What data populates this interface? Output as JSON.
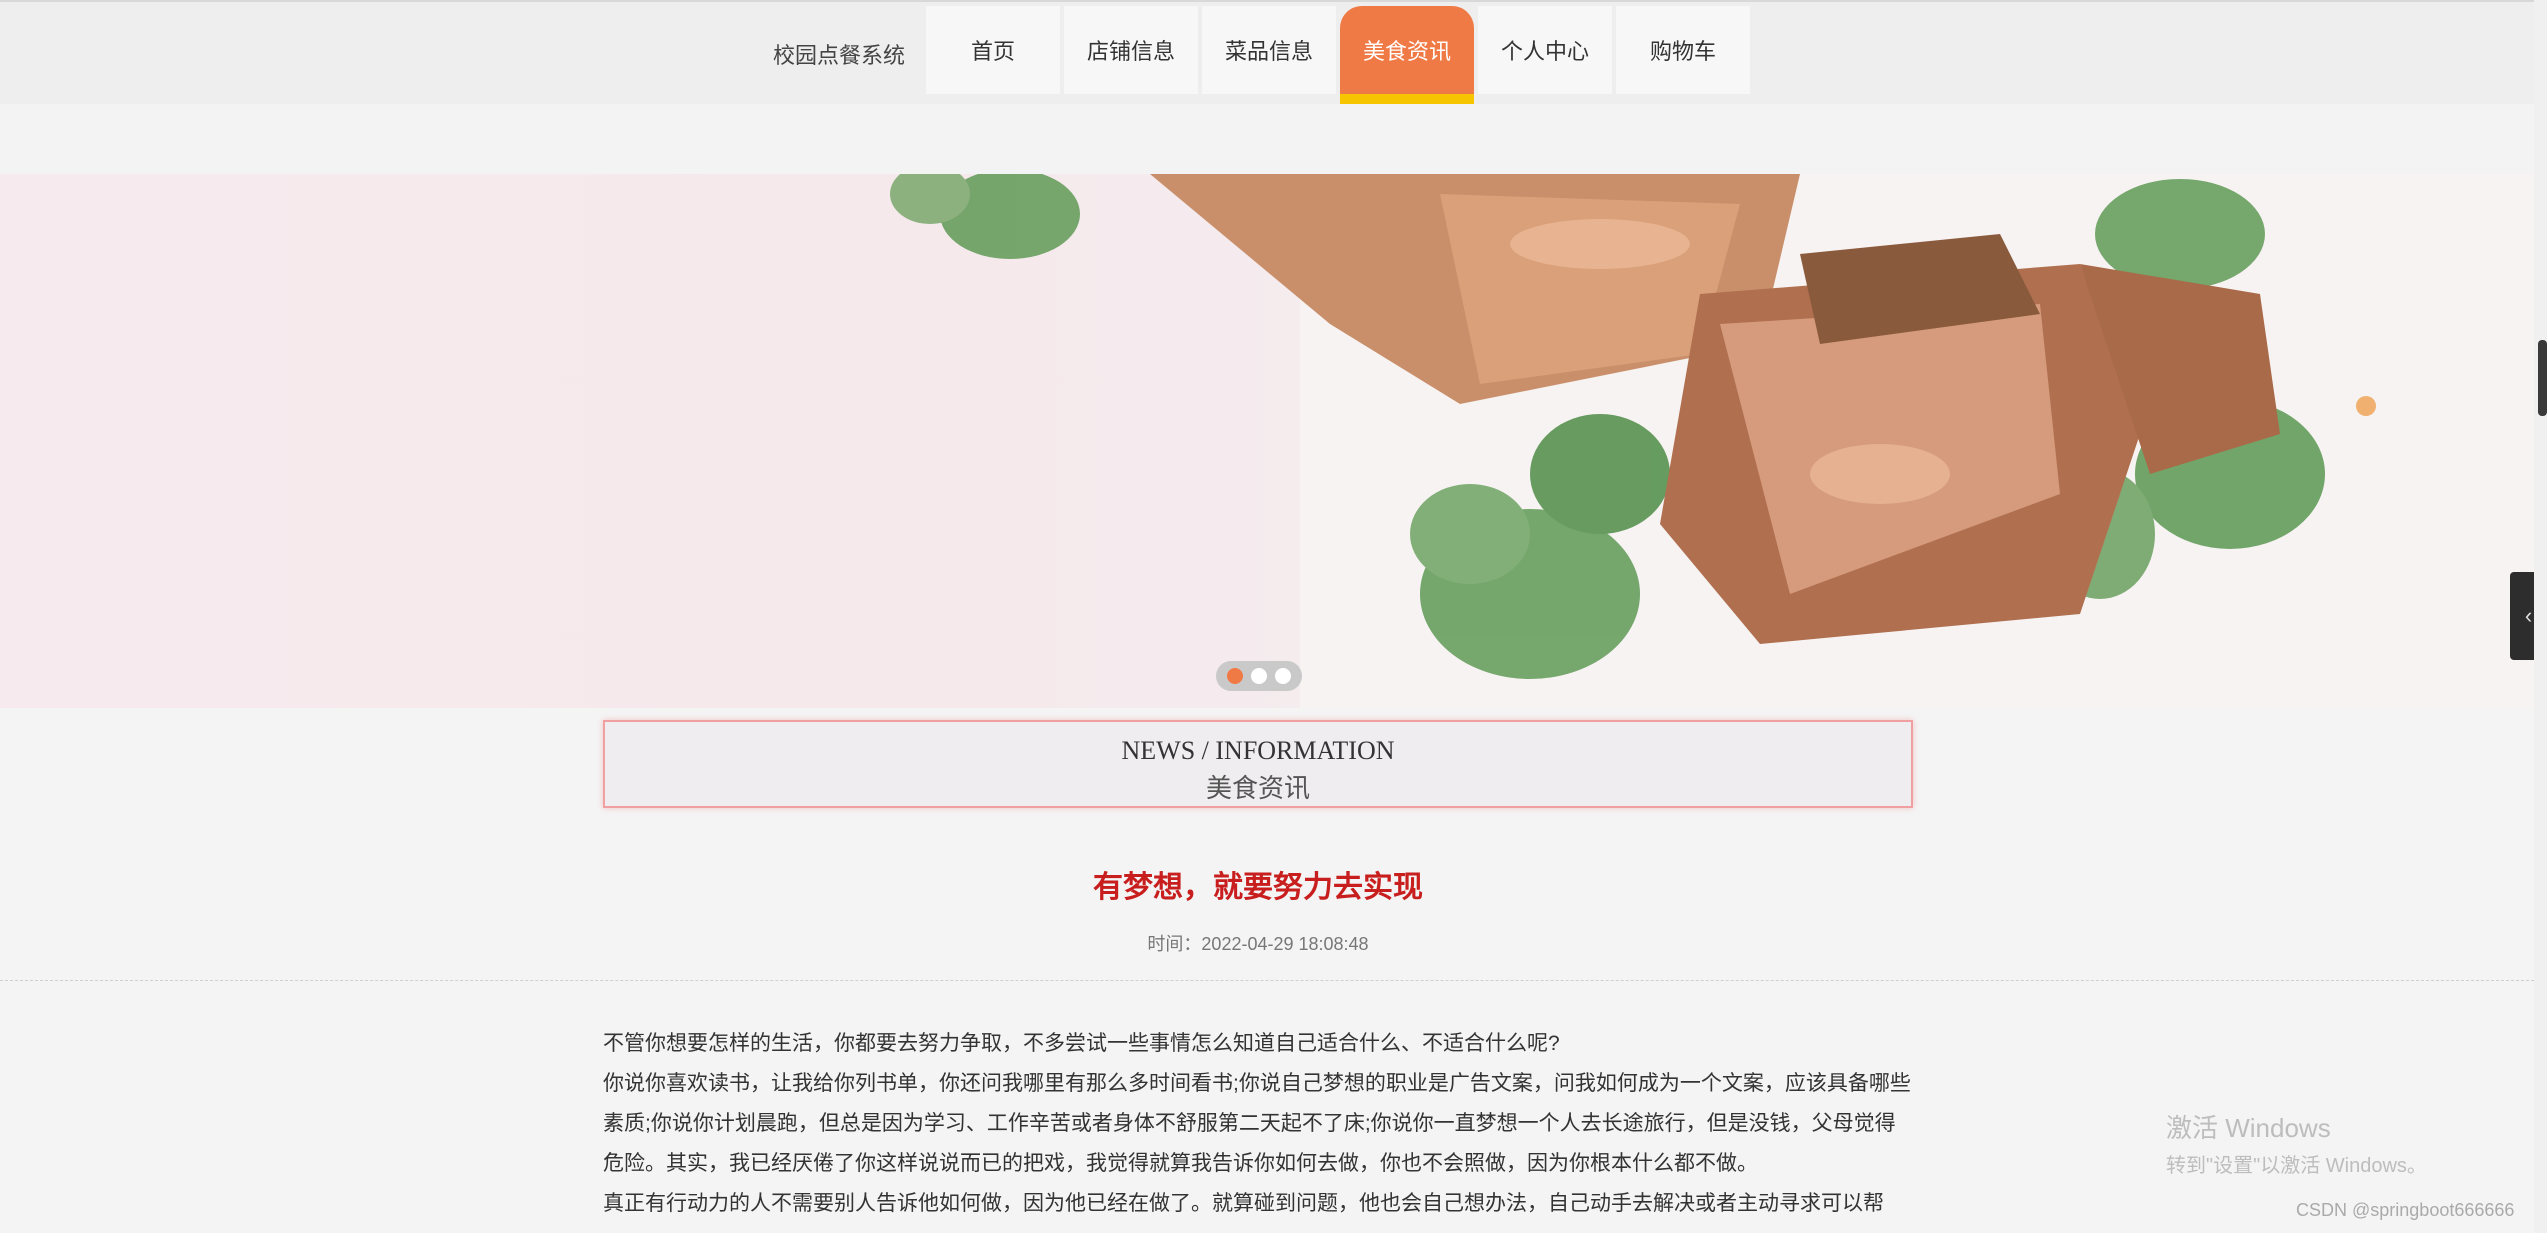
{
  "brand": "校园点餐系统",
  "nav": [
    {
      "label": "首页",
      "active": false
    },
    {
      "label": "店铺信息",
      "active": false
    },
    {
      "label": "菜品信息",
      "active": false
    },
    {
      "label": "美食资讯",
      "active": true
    },
    {
      "label": "个人中心",
      "active": false
    },
    {
      "label": "购物车",
      "active": false
    }
  ],
  "carousel": {
    "slides": 3,
    "active_index": 0
  },
  "section": {
    "title_en": "NEWS / INFORMATION",
    "title_cn": "美食资讯"
  },
  "article": {
    "title": "有梦想，就要努力去实现",
    "time": "时间：2022-04-29 18:08:48",
    "paragraphs": [
      "不管你想要怎样的生活，你都要去努力争取，不多尝试一些事情怎么知道自己适合什么、不适合什么呢?",
      "你说你喜欢读书，让我给你列书单，你还问我哪里有那么多时间看书;你说自己梦想的职业是广告文案，问我如何成为一个文案，应该具备哪些素质;你说你计划晨跑，但总是因为学习、工作辛苦或者身体不舒服第二天起不了床;你说你一直梦想一个人去长途旅行，但是没钱，父母觉得危险。其实，我已经厌倦了你这样说说而已的把戏，我觉得就算我告诉你如何去做，你也不会照做，因为你根本什么都不做。",
      "真正有行动力的人不需要别人告诉他如何做，因为他已经在做了。就算碰到问题，他也会自己想办法，自己动手去解决或者主动寻求可以帮"
    ]
  },
  "side_toggle": "‹",
  "watermark": {
    "line1": "激活 Windows",
    "line2": "转到\"设置\"以激活 Windows。"
  },
  "credit": "CSDN @springboot666666"
}
